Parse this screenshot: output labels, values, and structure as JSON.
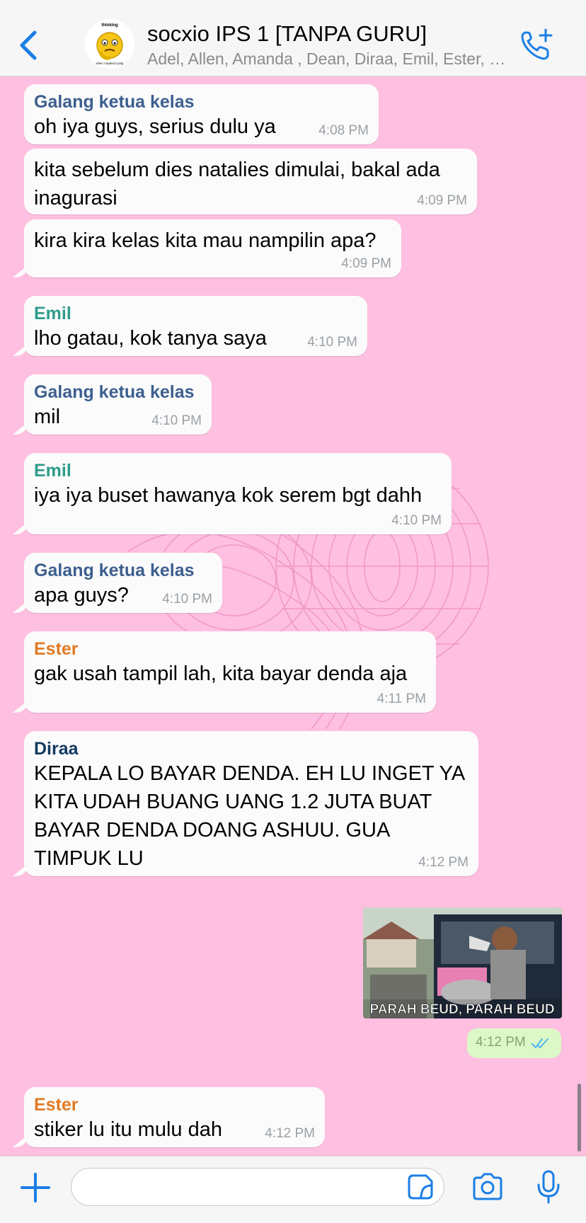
{
  "header": {
    "back_icon": "chevron-left-icon",
    "title": "socxio IPS 1 [TANPA GURU]",
    "subtitle": "Adel, Allen, Amanda , Dean, Diraa, Emil, Ester, Galang",
    "avatar_caption_top": "thinking",
    "avatar_caption_bottom": "when I started crying",
    "call_icon": "add-call-icon"
  },
  "messages": [
    {
      "sender": "Galang ketua kelas",
      "text": "oh iya guys, serius dulu ya",
      "time": "4:08 PM"
    },
    {
      "sender": "",
      "text": "kita sebelum dies natalies dimulai, bakal ada inagurasi",
      "time": "4:09 PM"
    },
    {
      "sender": "",
      "text": "kira kira kelas kita mau nampilin apa?",
      "time": "4:09 PM"
    },
    {
      "sender": "Emil",
      "text": "lho gatau, kok tanya saya",
      "time": "4:10 PM"
    },
    {
      "sender": "Galang ketua kelas",
      "text": "mil",
      "time": "4:10 PM"
    },
    {
      "sender": "Emil",
      "text": "iya iya buset hawanya kok serem bgt dahh",
      "time": "4:10 PM"
    },
    {
      "sender": "Galang ketua kelas",
      "text": "apa guys?",
      "time": "4:10 PM"
    },
    {
      "sender": "Ester",
      "text": "gak usah tampil lah, kita bayar denda aja",
      "time": "4:11 PM"
    },
    {
      "sender": "Diraa",
      "text": "KEPALA LO BAYAR DENDA. EH LU INGET YA KITA UDAH BUANG UANG 1.2 JUTA BUAT BAYAR DENDA DOANG ASHUU. GUA TIMPUK LU",
      "time": "4:12 PM"
    },
    {
      "sender": "Ester",
      "text": "stiker lu itu mulu dah",
      "time": "4:12 PM"
    }
  ],
  "outgoing": {
    "image_caption": "PARAH BEUD, PARAH BEUD",
    "time": "4:12 PM",
    "status_icon": "double-check-icon"
  },
  "composer": {
    "placeholder": "",
    "add_icon": "plus-icon",
    "sticker_icon": "sticker-icon",
    "camera_icon": "camera-icon",
    "mic_icon": "microphone-icon"
  },
  "colors": {
    "background": "#ffbfe0",
    "accent": "#1a7ee6",
    "sender_galang": "#3d5f8f",
    "sender_emil": "#2f9c8c",
    "sender_ester": "#e07a25",
    "sender_diraa": "#12395f",
    "outgoing_bubble": "#dcf8c6"
  }
}
